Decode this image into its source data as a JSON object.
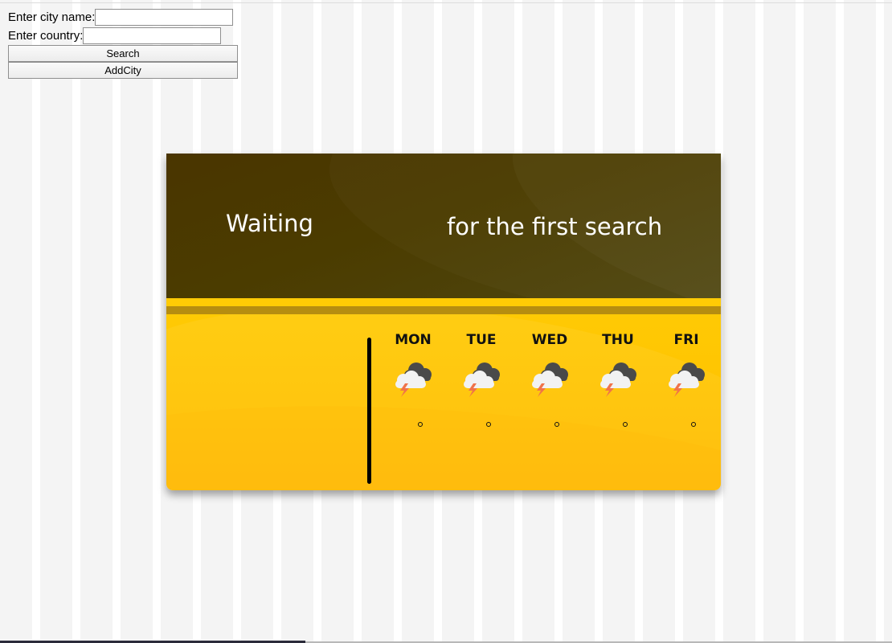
{
  "form": {
    "city_label": "Enter city name:",
    "city_value": "",
    "country_label": "Enter country:",
    "country_value": "",
    "search_button": "Search",
    "addcity_button": "AddCity"
  },
  "card": {
    "city": "Waiting",
    "status": "for the first search",
    "colors": {
      "header": "#4b3a00",
      "body": "#ffc400",
      "accent_stripe": "#b68d10"
    },
    "forecast": [
      {
        "day": "MON",
        "icon": "thunderstorm-icon",
        "temp": ""
      },
      {
        "day": "TUE",
        "icon": "thunderstorm-icon",
        "temp": ""
      },
      {
        "day": "WED",
        "icon": "thunderstorm-icon",
        "temp": ""
      },
      {
        "day": "THU",
        "icon": "thunderstorm-icon",
        "temp": ""
      },
      {
        "day": "FRI",
        "icon": "thunderstorm-icon",
        "temp": ""
      }
    ]
  }
}
